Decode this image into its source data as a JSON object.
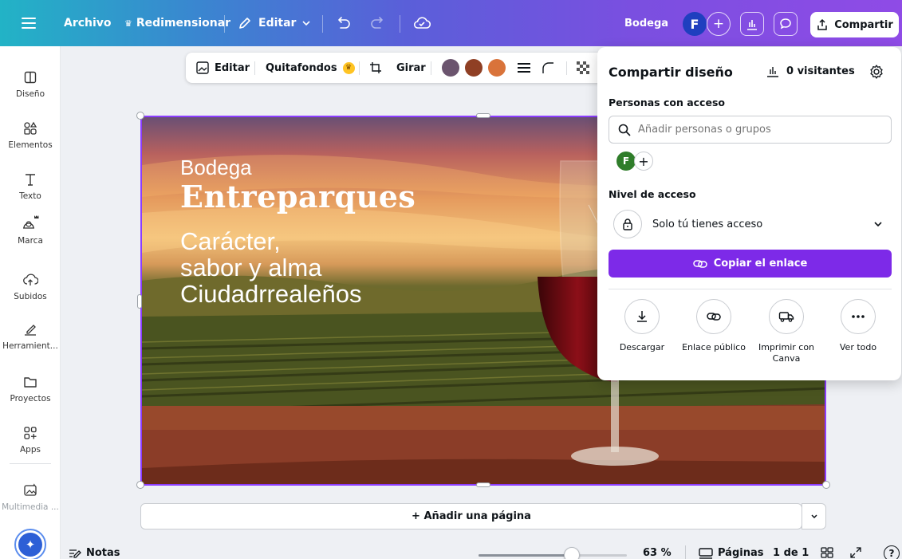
{
  "topbar": {
    "menu_icon": "hamburger-icon",
    "file_label": "Archivo",
    "resize_label": "Redimensionar",
    "edit_label": "Editar",
    "undo_icon": "undo-icon",
    "redo_icon": "redo-icon",
    "cloud_icon": "cloud-check-icon",
    "design_title": "Bodega",
    "avatar_initial": "F",
    "share_label": "Compartir",
    "colors": {
      "gradient_start": "#22b3c6",
      "gradient_end": "#8f4be6"
    }
  },
  "sidebar": {
    "items": [
      {
        "label": "Diseño",
        "icon": "layout-icon"
      },
      {
        "label": "Elementos",
        "icon": "shapes-icon"
      },
      {
        "label": "Texto",
        "icon": "text-icon"
      },
      {
        "label": "Marca",
        "icon": "brand-icon"
      },
      {
        "label": "Subidos",
        "icon": "cloud-upload-icon"
      },
      {
        "label": "Herramient...",
        "icon": "draw-icon"
      },
      {
        "label": "Proyectos",
        "icon": "folder-icon"
      },
      {
        "label": "Apps",
        "icon": "apps-icon"
      },
      {
        "label": "Multimedia ...",
        "icon": "media-icon"
      }
    ]
  },
  "context_toolbar": {
    "edit_label": "Editar",
    "bg_remover_label": "Quitafondos",
    "crop_icon": "crop-icon",
    "rotate_label": "Girar",
    "swatches": [
      "#6b546e",
      "#8f3f24",
      "#d9733a"
    ]
  },
  "canvas": {
    "line1": "Bodega",
    "line2": "Entreparques",
    "line3": "Carácter,",
    "line4": "sabor y alma",
    "line5": "Ciudadrrealeños"
  },
  "share_panel": {
    "title": "Compartir diseño",
    "visitors_label": "0 visitantes",
    "people_label": "Personas con acceso",
    "search_placeholder": "Añadir personas o grupos",
    "person_initial": "F",
    "access_level_label": "Nivel de acceso",
    "access_value": "Solo tú tienes acceso",
    "copy_link_label": "Copiar el enlace",
    "accent": "#7d2ae8",
    "actions": [
      {
        "label": "Descargar",
        "icon": "download-icon"
      },
      {
        "label": "Enlace público",
        "icon": "link-icon"
      },
      {
        "label": "Imprimir con Canva",
        "icon": "truck-icon"
      },
      {
        "label": "Ver todo",
        "icon": "more-icon"
      }
    ]
  },
  "footer": {
    "add_page_label": "+ Añadir una página",
    "notes_label": "Notas",
    "zoom_value": 0.63,
    "zoom_label": "63 %",
    "pages_label": "Páginas",
    "page_counter": "1 de 1"
  }
}
